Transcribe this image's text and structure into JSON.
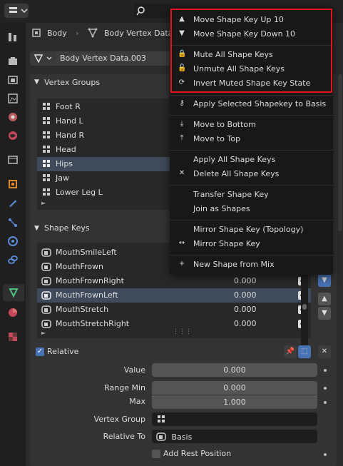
{
  "header": {
    "editor_icon": "properties-icon",
    "breadcrumb_object": "Body",
    "breadcrumb_data": "Body Vertex Data."
  },
  "datablock": {
    "name": "Body Vertex Data.003"
  },
  "tabs": [
    {
      "name": "tool-icon"
    },
    {
      "name": "render-icon"
    },
    {
      "name": "output-icon"
    },
    {
      "name": "view-layer-icon"
    },
    {
      "name": "scene-icon"
    },
    {
      "name": "world-icon"
    },
    {
      "name": "collection-icon"
    },
    {
      "name": "object-icon"
    },
    {
      "name": "modifier-icon"
    },
    {
      "name": "particles-icon"
    },
    {
      "name": "physics-icon"
    },
    {
      "name": "constraints-icon"
    },
    {
      "name": "data-icon"
    },
    {
      "name": "material-icon"
    },
    {
      "name": "texture-icon"
    }
  ],
  "vertex_groups": {
    "title": "Vertex Groups",
    "items": [
      "Foot R",
      "Hand L",
      "Hand R",
      "Head",
      "Hips",
      "Jaw",
      "Lower Leg L"
    ],
    "selected": "Hips"
  },
  "shape_keys": {
    "title": "Shape Keys",
    "items": [
      {
        "name": "MouthSmileLeft",
        "value": "",
        "checked": false
      },
      {
        "name": "MouthFrown",
        "value": "",
        "checked": false
      },
      {
        "name": "MouthFrownRight",
        "value": "0.000",
        "checked": true
      },
      {
        "name": "MouthFrownLeft",
        "value": "0.000",
        "checked": true
      },
      {
        "name": "MouthStretch",
        "value": "0.000",
        "checked": true
      },
      {
        "name": "MouthStretchRight",
        "value": "0.000",
        "checked": true
      }
    ],
    "selected": "MouthFrownLeft"
  },
  "relative": {
    "label": "Relative",
    "value_label": "Value",
    "value": "0.000",
    "range_min_label": "Range Min",
    "range_min": "0.000",
    "max_label": "Max",
    "max": "1.000",
    "vertex_group_label": "Vertex Group",
    "relative_to_label": "Relative To",
    "relative_to": "Basis",
    "add_rest_label": "Add Rest Position"
  },
  "menu": {
    "items": [
      {
        "label": "Move Shape Key Up 10",
        "icon": "triangle-up-icon",
        "glyph": "▲"
      },
      {
        "label": "Move Shape Key Down 10",
        "icon": "triangle-down-icon",
        "glyph": "▼"
      },
      {
        "label": "Mute All Shape Keys",
        "icon": "lock-icon",
        "glyph": "🔒"
      },
      {
        "label": "Unmute All Shape Keys",
        "icon": "unlock-icon",
        "glyph": "🔓"
      },
      {
        "label": "Invert Muted Shape Key State",
        "icon": "refresh-icon",
        "glyph": "⟳"
      },
      {
        "label": "Apply Selected Shapekey to Basis",
        "icon": "key-add-icon",
        "glyph": "⚷"
      },
      {
        "label": "Move to Bottom",
        "icon": "move-bottom-icon",
        "glyph": "⤓"
      },
      {
        "label": "Move to Top",
        "icon": "move-top-icon",
        "glyph": "⤒"
      },
      {
        "label": "Apply All Shape Keys",
        "icon": "",
        "glyph": ""
      },
      {
        "label": "Delete All Shape Keys",
        "icon": "x-icon",
        "glyph": "✕"
      },
      {
        "label": "Transfer Shape Key",
        "icon": "",
        "glyph": ""
      },
      {
        "label": "Join as Shapes",
        "icon": "",
        "glyph": ""
      },
      {
        "label": "Mirror Shape Key (Topology)",
        "icon": "",
        "glyph": ""
      },
      {
        "label": "Mirror Shape Key",
        "icon": "arrows-horizontal-icon",
        "glyph": "↔"
      },
      {
        "label": "New Shape from Mix",
        "icon": "plus-icon",
        "glyph": "+"
      }
    ]
  },
  "colors": {
    "highlight_border": "#e0141a",
    "accent": "#4772b3"
  }
}
